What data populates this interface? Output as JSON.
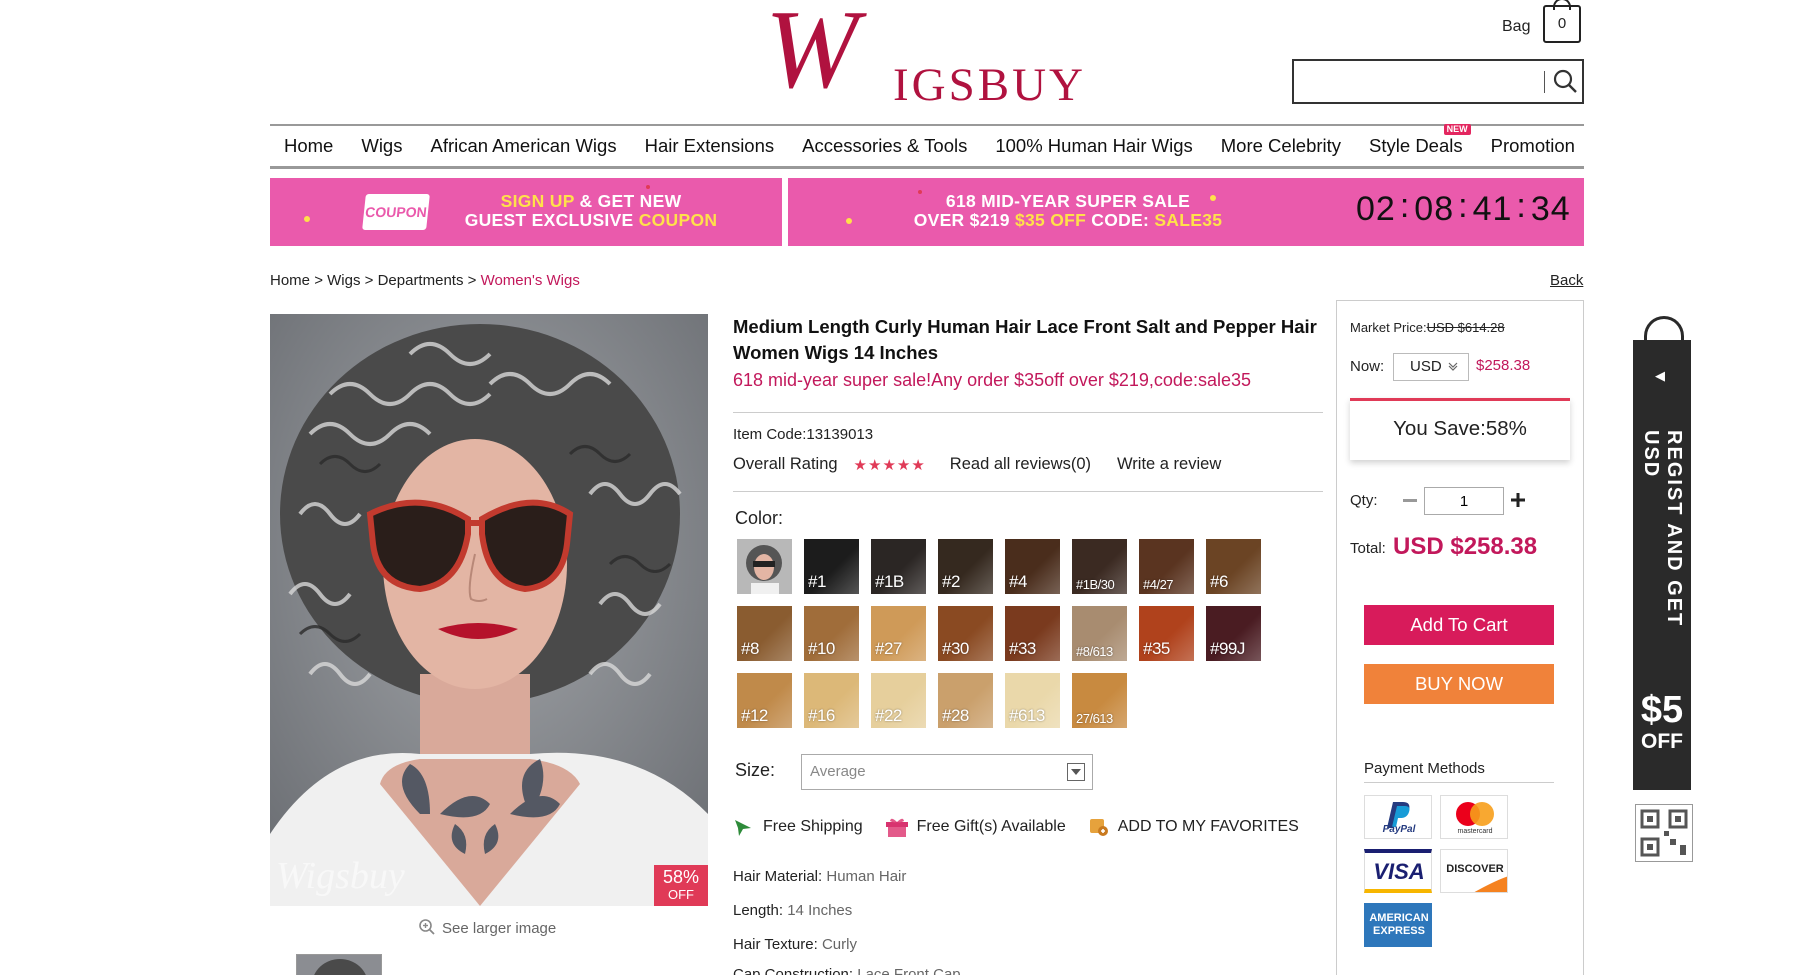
{
  "header": {
    "logo_text": "WIGSBUY",
    "bag_label": "Bag",
    "bag_count": "0",
    "search_placeholder": ""
  },
  "nav": {
    "items": [
      "Home",
      "Wigs",
      "African American Wigs",
      "Hair Extensions",
      "Accessories & Tools",
      "100% Human Hair Wigs",
      "More Celebrity",
      "Style Deals",
      "Promotion"
    ],
    "new_badge": "NEW"
  },
  "banners": {
    "coupon_tag": "COUPON",
    "signup_line1_a": "SIGN UP",
    "signup_line1_b": " & GET NEW",
    "signup_line2_a": "GUEST EXCLUSIVE ",
    "signup_line2_b": "COUPON",
    "sale_line1": "618 MID-YEAR SUPER SALE",
    "sale_line2_a": "OVER $219 ",
    "sale_line2_b": "$35 OFF",
    "sale_line2_c": "  CODE: ",
    "sale_line2_d": "SALE35",
    "countdown": [
      "02",
      "08",
      "41",
      "34"
    ]
  },
  "breadcrumb": {
    "items": [
      "Home",
      "Wigs",
      "Departments"
    ],
    "current": "Women's Wigs",
    "separator": ">",
    "back": "Back"
  },
  "product": {
    "title": "Medium Length Curly Human Hair Lace Front Salt and Pepper Hair Women Wigs 14 Inches",
    "promo": "618 mid-year super sale!Any order $35off over $219,code:sale35",
    "item_code": "Item Code:13139013",
    "rating_label": "Overall Rating",
    "stars": "★★★★★",
    "read_reviews": "Read all reviews(0)",
    "write_review": "Write a review",
    "color_label": "Color:",
    "colors": [
      {
        "label": "",
        "hex": "#8a8a8a"
      },
      {
        "label": "#1",
        "hex": "#1c1c1c"
      },
      {
        "label": "#1B",
        "hex": "#2b2624"
      },
      {
        "label": "#2",
        "hex": "#35291f"
      },
      {
        "label": "#4",
        "hex": "#4a2d1c"
      },
      {
        "label": "#1B/30",
        "hex": "#3b2a22"
      },
      {
        "label": "#4/27",
        "hex": "#5a3420"
      },
      {
        "label": "#6",
        "hex": "#6b4424"
      },
      {
        "label": "#8",
        "hex": "#8a5c30"
      },
      {
        "label": "#10",
        "hex": "#a06d3a"
      },
      {
        "label": "#27",
        "hex": "#cf9a58"
      },
      {
        "label": "#30",
        "hex": "#8a4a22"
      },
      {
        "label": "#33",
        "hex": "#7a3a1e"
      },
      {
        "label": "#8/613",
        "hex": "#a88c70"
      },
      {
        "label": "#35",
        "hex": "#b0421c"
      },
      {
        "label": "#99J",
        "hex": "#4a1c22"
      },
      {
        "label": "#12",
        "hex": "#c08a4a"
      },
      {
        "label": "#16",
        "hex": "#dcb878"
      },
      {
        "label": "#22",
        "hex": "#e6cf9c"
      },
      {
        "label": "#28",
        "hex": "#caa06c"
      },
      {
        "label": "#613",
        "hex": "#ead8aa"
      },
      {
        "label": "27/613",
        "hex": "#c88a40"
      }
    ],
    "size_label": "Size:",
    "size_value": "Average",
    "features": [
      "Free Shipping",
      "Free Gift(s) Available",
      "ADD TO MY FAVORITES"
    ],
    "specs": [
      {
        "k": "Hair Material: ",
        "v": "Human Hair"
      },
      {
        "k": "Length: ",
        "v": "14 Inches"
      },
      {
        "k": "Hair Texture: ",
        "v": "Curly"
      },
      {
        "k": "Cap Construction: ",
        "v": "Lace Front Cap"
      }
    ],
    "discount_badge": "58%",
    "discount_badge_sub": "OFF",
    "see_larger": "See larger image",
    "watermark": "Wigsbuy"
  },
  "purchase": {
    "market_label": "Market Price:",
    "market_price": "USD $614.28",
    "now_label": "Now:",
    "currency": "USD",
    "now_price": "$258.38",
    "you_save": "You Save:58%",
    "qty_label": "Qty:",
    "qty": "1",
    "total_label": "Total:",
    "total": "USD $258.38",
    "add_to_cart": "Add To Cart",
    "buy_now": "BUY NOW",
    "payment_title": "Payment Methods",
    "payment_methods": [
      "PayPal",
      "mastercard",
      "VISA",
      "DISCOVER",
      "AMERICAN EXPRESS"
    ]
  },
  "side_widget": {
    "text": "REGIST AND GET USD",
    "amount": "$5",
    "off": "OFF"
  },
  "colors": {
    "brand": "#b0123f",
    "banner": "#ea5aac",
    "accent": "#c2185b",
    "cart": "#d81b5b",
    "buy": "#f0823a"
  }
}
